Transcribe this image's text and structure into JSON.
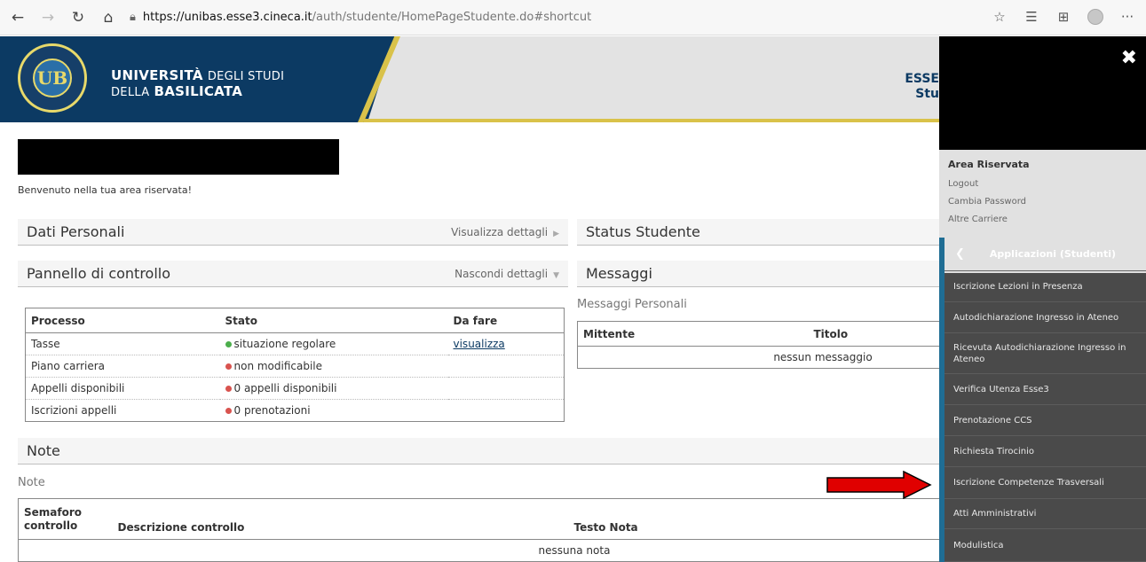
{
  "browser": {
    "url_host": "https://unibas.esse3.cineca.it",
    "url_path": "/auth/studente/HomePageStudente.do#shortcut"
  },
  "header": {
    "university_line1_bold": "UNIVERSITÀ",
    "university_line1_light": "DEGLI STUDI",
    "university_line2_light": "DELLA",
    "university_line2_bold": "BASILICATA",
    "right_line1": "ESSE",
    "right_line2": "Stu"
  },
  "welcome": "Benvenuto nella tua area riservata!",
  "dati_personali": {
    "title": "Dati Personali",
    "action": "Visualizza dettagli"
  },
  "status_studente": {
    "title": "Status Studente"
  },
  "pannello": {
    "title": "Pannello di controllo",
    "action": "Nascondi dettagli",
    "columns": [
      "Processo",
      "Stato",
      "Da fare"
    ],
    "rows": [
      {
        "processo": "Tasse",
        "stato": "situazione regolare",
        "status_color": "green",
        "da_fare": "visualizza"
      },
      {
        "processo": "Piano carriera",
        "stato": "non modificabile",
        "status_color": "red",
        "da_fare": ""
      },
      {
        "processo": "Appelli disponibili",
        "stato": "0 appelli disponibili",
        "status_color": "red",
        "da_fare": ""
      },
      {
        "processo": "Iscrizioni appelli",
        "stato": "0 prenotazioni",
        "status_color": "red",
        "da_fare": ""
      }
    ]
  },
  "messaggi": {
    "title": "Messaggi",
    "subtitle": "Messaggi Personali",
    "columns": [
      "Mittente",
      "Titolo"
    ],
    "empty": "nessun messaggio"
  },
  "note": {
    "title": "Note",
    "subtitle": "Note",
    "col1_line1": "Semaforo",
    "col1_line2": "controllo",
    "col2": "Descrizione controllo",
    "col3": "Testo Nota",
    "empty": "nessuna nota"
  },
  "sidebar": {
    "area_title": "Area Riservata",
    "links": [
      "Logout",
      "Cambia Password",
      "Altre Carriere"
    ],
    "menu_title": "Applicazioni (Studenti)",
    "items": [
      "Iscrizione Lezioni in Presenza",
      "Autodichiarazione Ingresso in Ateneo",
      "Ricevuta Autodichiarazione Ingresso in Ateneo",
      "Verifica Utenza Esse3",
      "Prenotazione CCS",
      "Richiesta Tirocinio",
      "Iscrizione Competenze Trasversali",
      "Atti Amministrativi",
      "Modulistica"
    ]
  },
  "colors": {
    "brand_blue": "#0c3a63",
    "brand_gold": "#d9c24a",
    "sidebar_bg": "#4a4a4a",
    "arrow_red": "#e00000"
  }
}
